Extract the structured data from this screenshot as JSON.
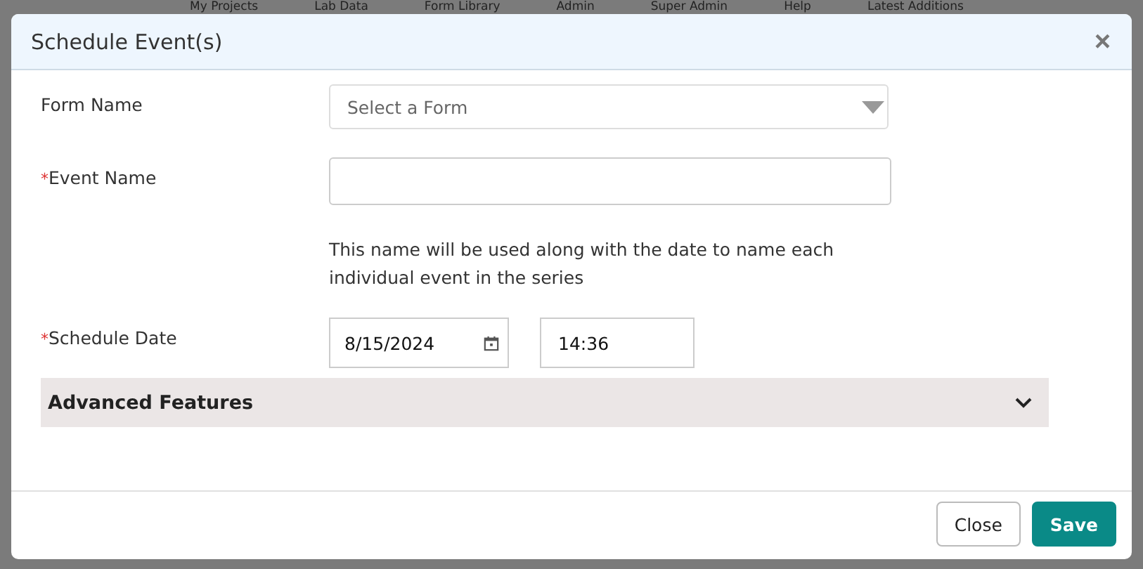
{
  "background_nav": [
    "My Projects",
    "Lab Data",
    "Form Library",
    "Admin",
    "Super Admin",
    "Help",
    "Latest Additions"
  ],
  "dialog": {
    "title": "Schedule Event(s)",
    "close_icon": "×",
    "fields": [
      {
        "kind": "select",
        "label": "Form Name",
        "required": false,
        "placeholder": "Select a Form"
      },
      {
        "kind": "text",
        "label": "Event Name",
        "required": true,
        "help": "This name will be used along with the date to name each individual event in the series"
      },
      {
        "kind": "datetime",
        "label": "Schedule Date",
        "required": true,
        "date": "8/15/2024",
        "time": "14:36"
      }
    ],
    "required_mark": "*",
    "advanced": {
      "label": "Advanced Features",
      "expanded": false
    },
    "buttons": [
      {
        "label": "Close",
        "kind": "secondary"
      },
      {
        "label": "Save",
        "kind": "primary"
      }
    ]
  }
}
